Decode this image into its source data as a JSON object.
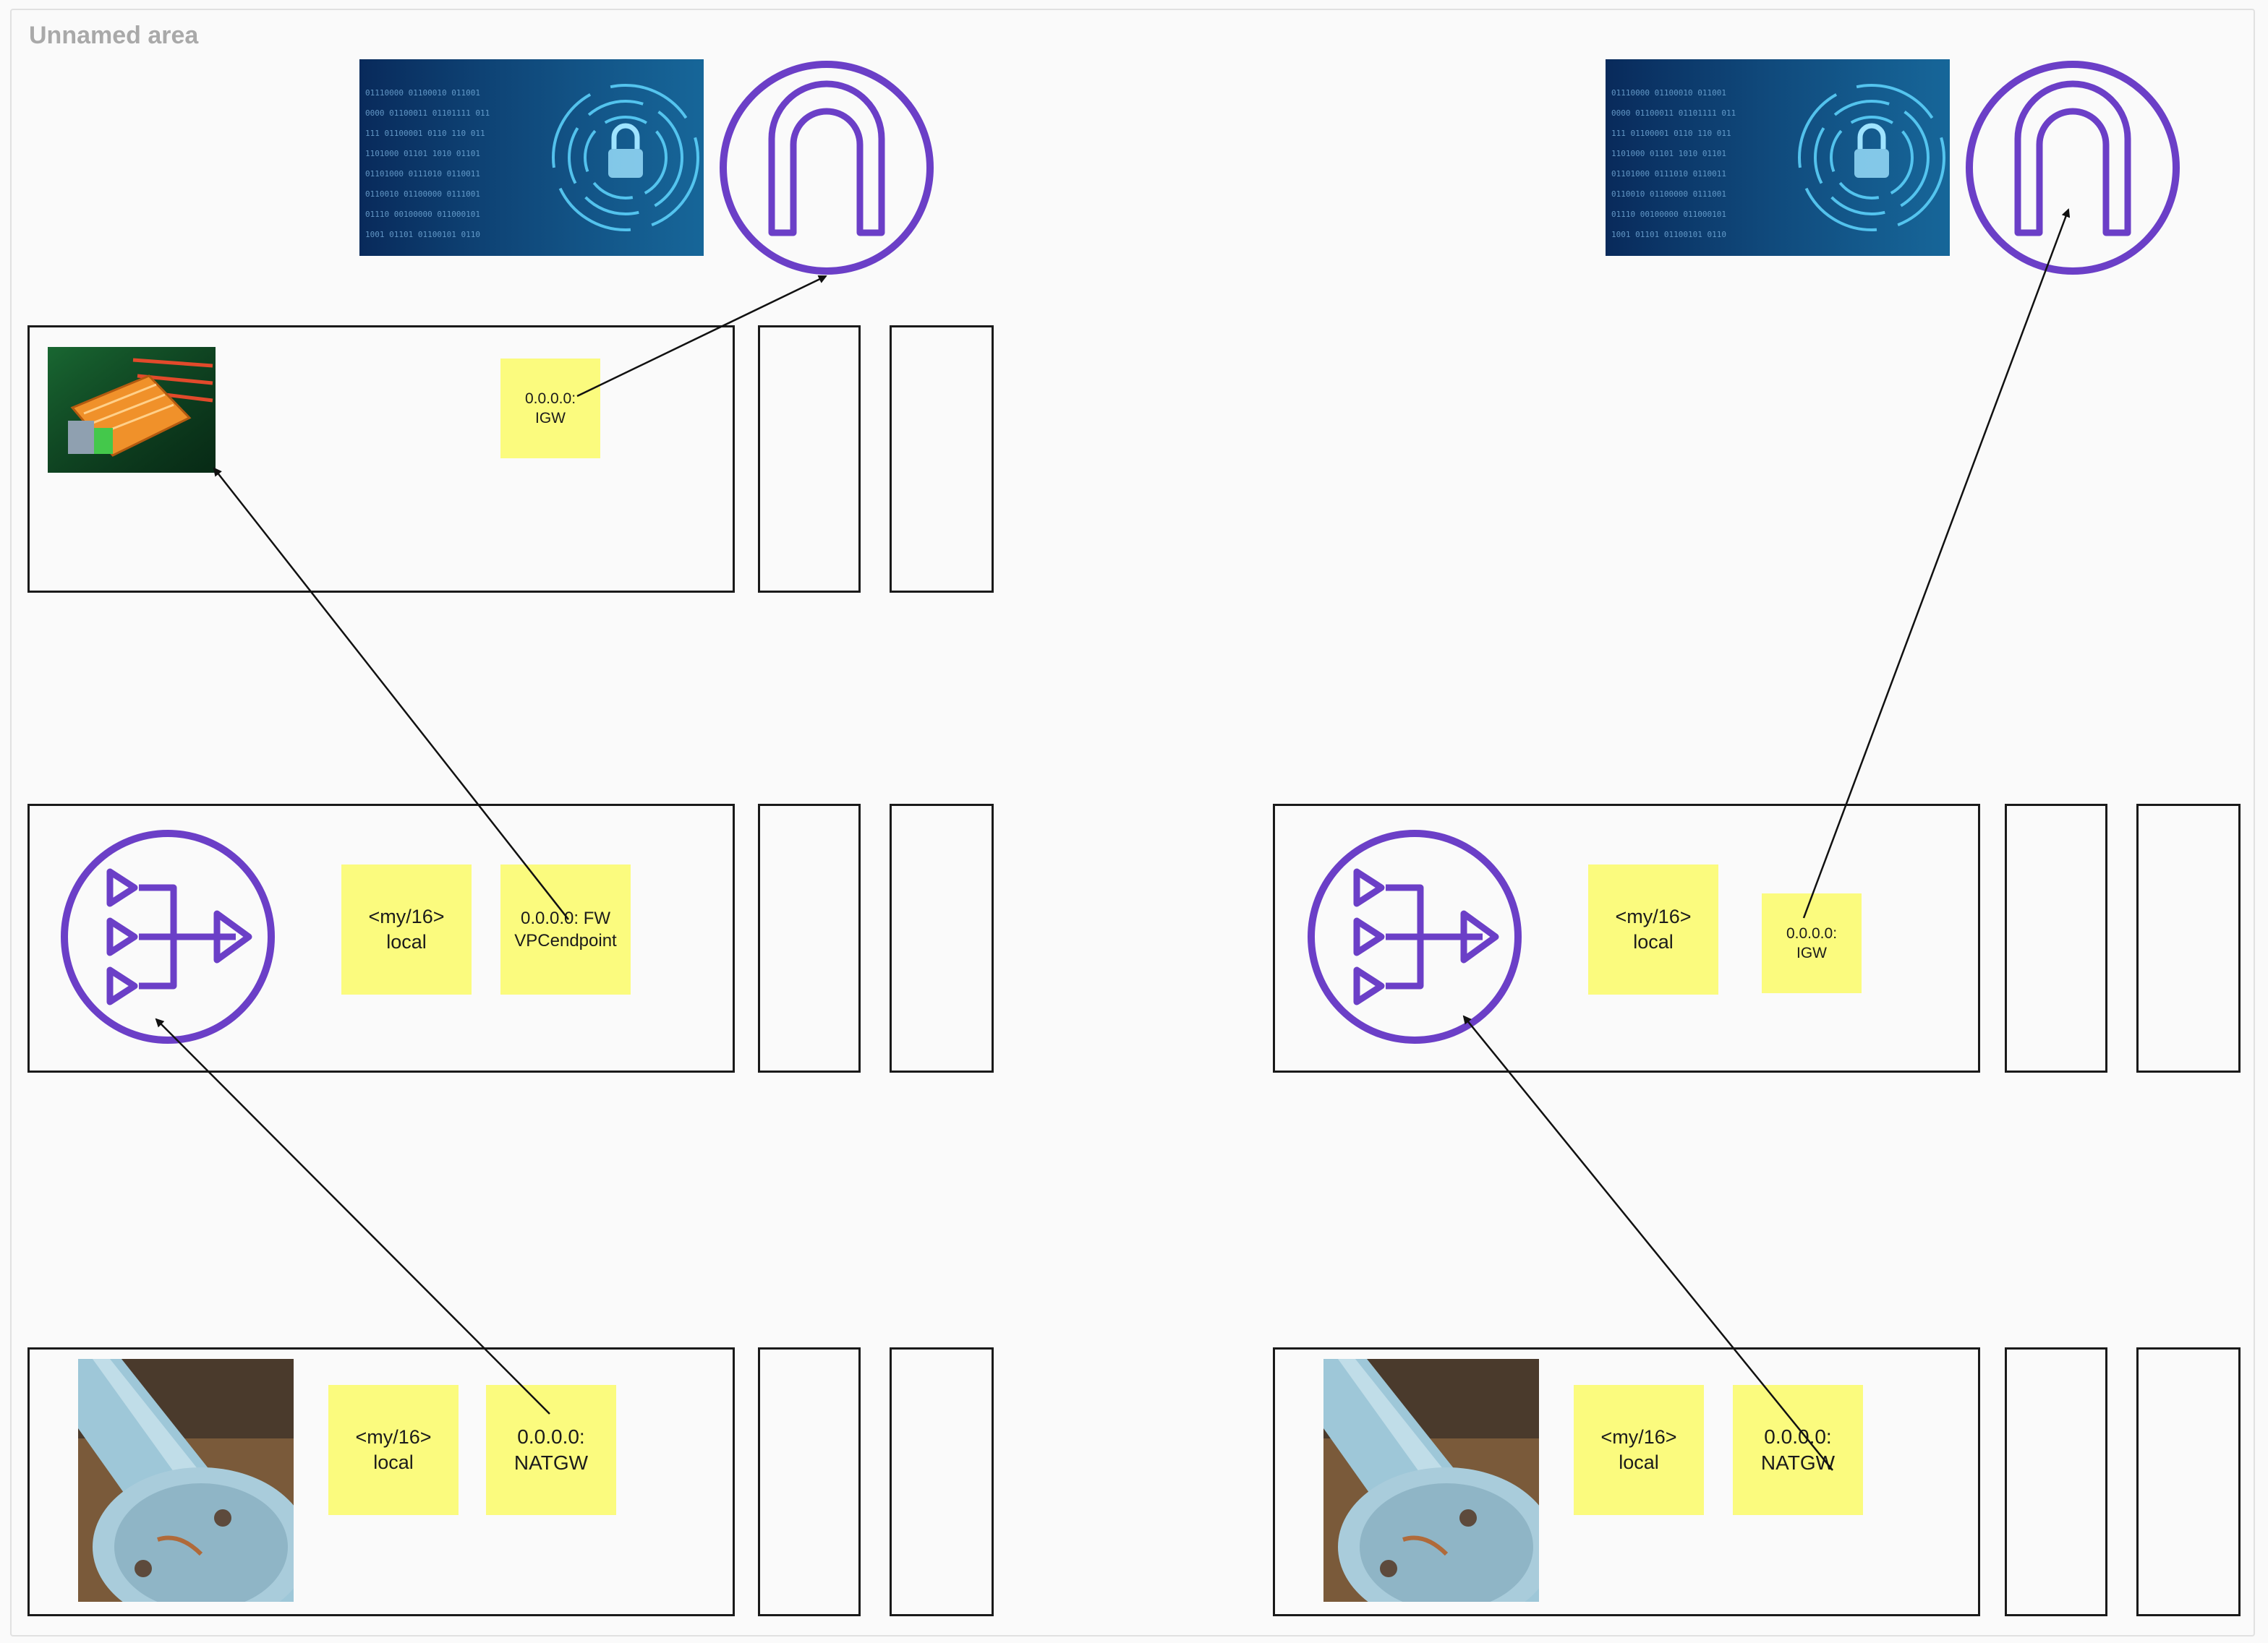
{
  "area": {
    "label": "Unnamed area"
  },
  "left": {
    "subnet_top": {
      "sticky": {
        "line1": "0.0.0.0:",
        "line2": "IGW"
      }
    },
    "subnet_middle": {
      "sticky_local": {
        "line1": "<my/16>",
        "line2": "local"
      },
      "sticky_route": {
        "line1": "0.0.0.0: FW",
        "line2": "VPCendpoint"
      }
    },
    "subnet_bottom": {
      "sticky_local": {
        "line1": "<my/16>",
        "line2": "local"
      },
      "sticky_route": {
        "line1": "0.0.0.0:",
        "line2": "NATGW"
      }
    }
  },
  "right": {
    "subnet_middle": {
      "sticky_local": {
        "line1": "<my/16>",
        "line2": "local"
      },
      "sticky_route": {
        "line1": "0.0.0.0:",
        "line2": "IGW"
      }
    },
    "subnet_bottom": {
      "sticky_local": {
        "line1": "<my/16>",
        "line2": "local"
      },
      "sticky_route": {
        "line1": "0.0.0.0:",
        "line2": "NATGW"
      }
    }
  },
  "icons": {
    "internet_gateway": "internet-gateway-icon",
    "nat_gateway": "nat-gateway-icon",
    "firewall": "firewall-network-card-image",
    "security": "security-lock-image",
    "pipeline": "pipeline-image"
  },
  "colors": {
    "sticky": "#fbfb7e",
    "aws_icon": "#6b3fc7",
    "outline": "#1a1a1a",
    "area_label": "#a9a9a9"
  }
}
